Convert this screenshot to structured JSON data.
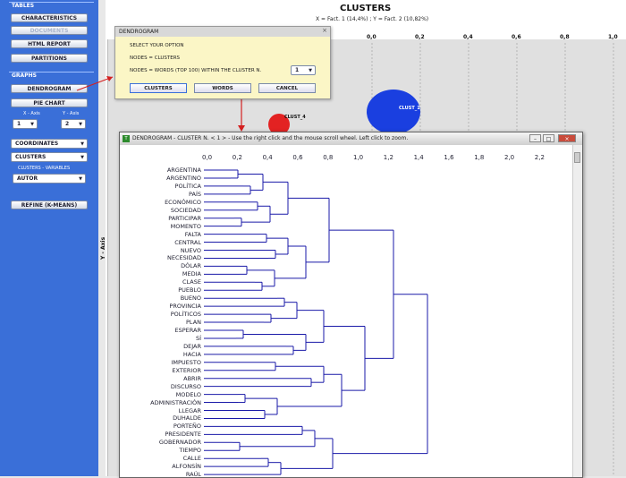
{
  "sidebar": {
    "tables_title": "TABLES",
    "tables_buttons": [
      "CHARACTERISTICS",
      "DOCUMENTS",
      "HTML REPORT",
      "PARTITIONS"
    ],
    "graphs_title": "GRAPHS",
    "graph_buttons": [
      "DENDROGRAM",
      "PIE CHART"
    ],
    "x_axis_label": "X - Axis",
    "y_axis_label": "Y - Axis",
    "x_axis_value": "1",
    "y_axis_value": "2",
    "coordinates_value": "COORDINATES",
    "clusters_value": "CLUSTERS",
    "clusters_variables_label": "CLUSTERS - VARIABLES",
    "variable_value": "AUTOR",
    "refine_button": "REFINE (K-MEANS)"
  },
  "plot": {
    "title": "CLUSTERS",
    "subtitle": "X = Fact. 1 (14,4%) ; Y = Fact. 2 (10,82%)",
    "x_ticks": [
      "0,0",
      "0,2",
      "0,4",
      "0,6",
      "0,8",
      "1,0"
    ],
    "y_axis_label": "Y - Axis",
    "clusters": [
      {
        "label": "CLUST_4",
        "color": "#e32222"
      },
      {
        "label": "CLUST_1",
        "color": "#1a3fe0"
      }
    ]
  },
  "dialog": {
    "title": "DENDROGRAM",
    "prompt": "SELECT YOUR OPTION",
    "option1": "NODES = CLUSTERS",
    "option2": "NODES = WORDS (TOP 100)  WITHIN THE CLUSTER  N.",
    "cluster_number": "1",
    "buttons": [
      "CLUSTERS",
      "WORDS",
      "CANCEL"
    ]
  },
  "dendrogram_window": {
    "title": "DENDROGRAM - CLUSTER N. < 1 > - Use the right click and the mouse scroll wheel. Left click to zoom.",
    "x_ticks": [
      "0,0",
      "0,2",
      "0,4",
      "0,6",
      "0,8",
      "1,0",
      "1,2",
      "1,4",
      "1,6",
      "1,8",
      "2,0",
      "2,2"
    ],
    "leaves": [
      "ARGENTINA",
      "ARGENTINO",
      "POLÍTICA",
      "PAÍS",
      "ECONÓMICO",
      "SOCIEDAD",
      "PARTICIPAR",
      "MOMENTO",
      "FALTA",
      "CENTRAL",
      "NUEVO",
      "NECESIDAD",
      "DÓLAR",
      "MEDIA",
      "CLASE",
      "PUEBLO",
      "BUENO",
      "PROVINCIA",
      "POLÍTICOS",
      "PLAN",
      "ESPERAR",
      "SÍ",
      "DEJAR",
      "HACIA",
      "IMPUESTO",
      "EXTERIOR",
      "ABRIR",
      "DISCURSO",
      "MODELO",
      "ADMINISTRACIÓN",
      "LLEGAR",
      "DUHALDE",
      "PORTEÑO",
      "PRESIDENTE",
      "GOBERNADOR",
      "TIEMPO",
      "CALLE",
      "ALFONSÍN",
      "RAÚL"
    ],
    "line_color": "#1a1aa8"
  }
}
